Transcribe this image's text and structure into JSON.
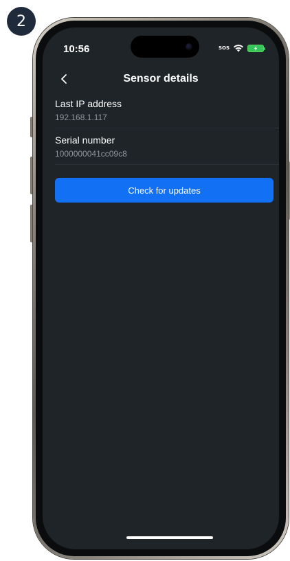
{
  "step_badge": {
    "number": "2"
  },
  "status_bar": {
    "time": "10:56",
    "sos": "SOS"
  },
  "header": {
    "title": "Sensor details",
    "back_icon": "chevron-left-icon"
  },
  "details": [
    {
      "label": "Last IP address",
      "value": "192.168.1.117"
    },
    {
      "label": "Serial number",
      "value": "1000000041cc09c8"
    }
  ],
  "actions": {
    "check_updates_label": "Check for updates"
  },
  "colors": {
    "background": "#1f2428",
    "primary": "#1270f5",
    "text_primary": "#ffffff",
    "text_secondary": "#8f969d",
    "battery": "#35c759"
  },
  "icons": {
    "wifi": "wifi-icon",
    "battery": "battery-charging-icon"
  }
}
